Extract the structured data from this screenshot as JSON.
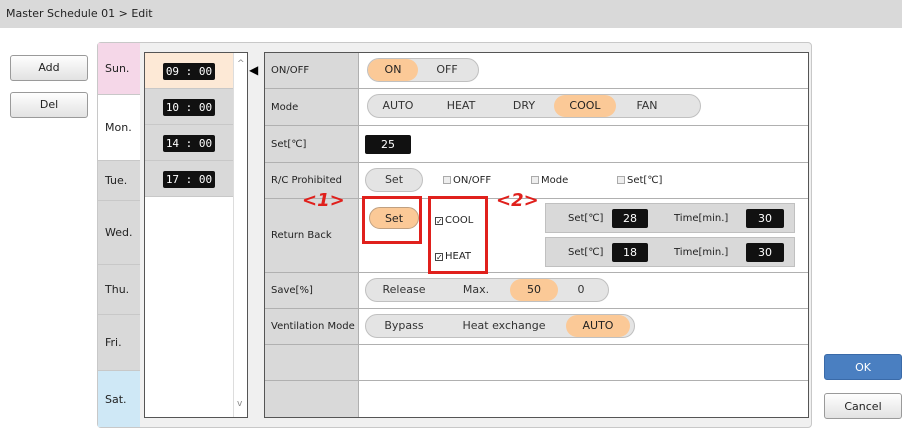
{
  "breadcrumb": "Master Schedule 01 > Edit",
  "side_buttons": {
    "add": "Add",
    "del": "Del"
  },
  "days": [
    "Sun.",
    "Mon.",
    "Tue.",
    "Wed.",
    "Thu.",
    "Fri.",
    "Sat."
  ],
  "times": [
    "09 : 00",
    "10 : 00",
    "14 : 00",
    "17 : 00"
  ],
  "labels": {
    "onoff": "ON/OFF",
    "mode": "Mode",
    "set": "Set[℃]",
    "rc": "R/C Prohibited",
    "return_back": "Return Back",
    "save": "Save[%]",
    "vent": "Ventilation Mode"
  },
  "onoff_opts": [
    "ON",
    "OFF"
  ],
  "mode_opts": [
    "AUTO",
    "HEAT",
    "DRY",
    "COOL",
    "FAN"
  ],
  "set_value": "25",
  "rc": {
    "set": "Set",
    "onoff": "ON/OFF",
    "mode": "Mode",
    "setc": "Set[℃]"
  },
  "return_back": {
    "set": "Set",
    "cool": "COOL",
    "heat": "HEAT",
    "set_label": "Set[℃]",
    "time_label": "Time[min.]",
    "cool_set": "28",
    "cool_time": "30",
    "heat_set": "18",
    "heat_time": "30"
  },
  "save_opts": [
    "Release",
    "Max.",
    "50",
    "0"
  ],
  "vent_opts": [
    "Bypass",
    "Heat exchange",
    "AUTO"
  ],
  "annotations": {
    "a1": "<1>",
    "a2": "<2>"
  },
  "actions": {
    "ok": "OK",
    "cancel": "Cancel"
  },
  "colors": {
    "selected": "#fbc997",
    "ok_button": "#4a7fc1",
    "highlight": "#e0201c"
  }
}
